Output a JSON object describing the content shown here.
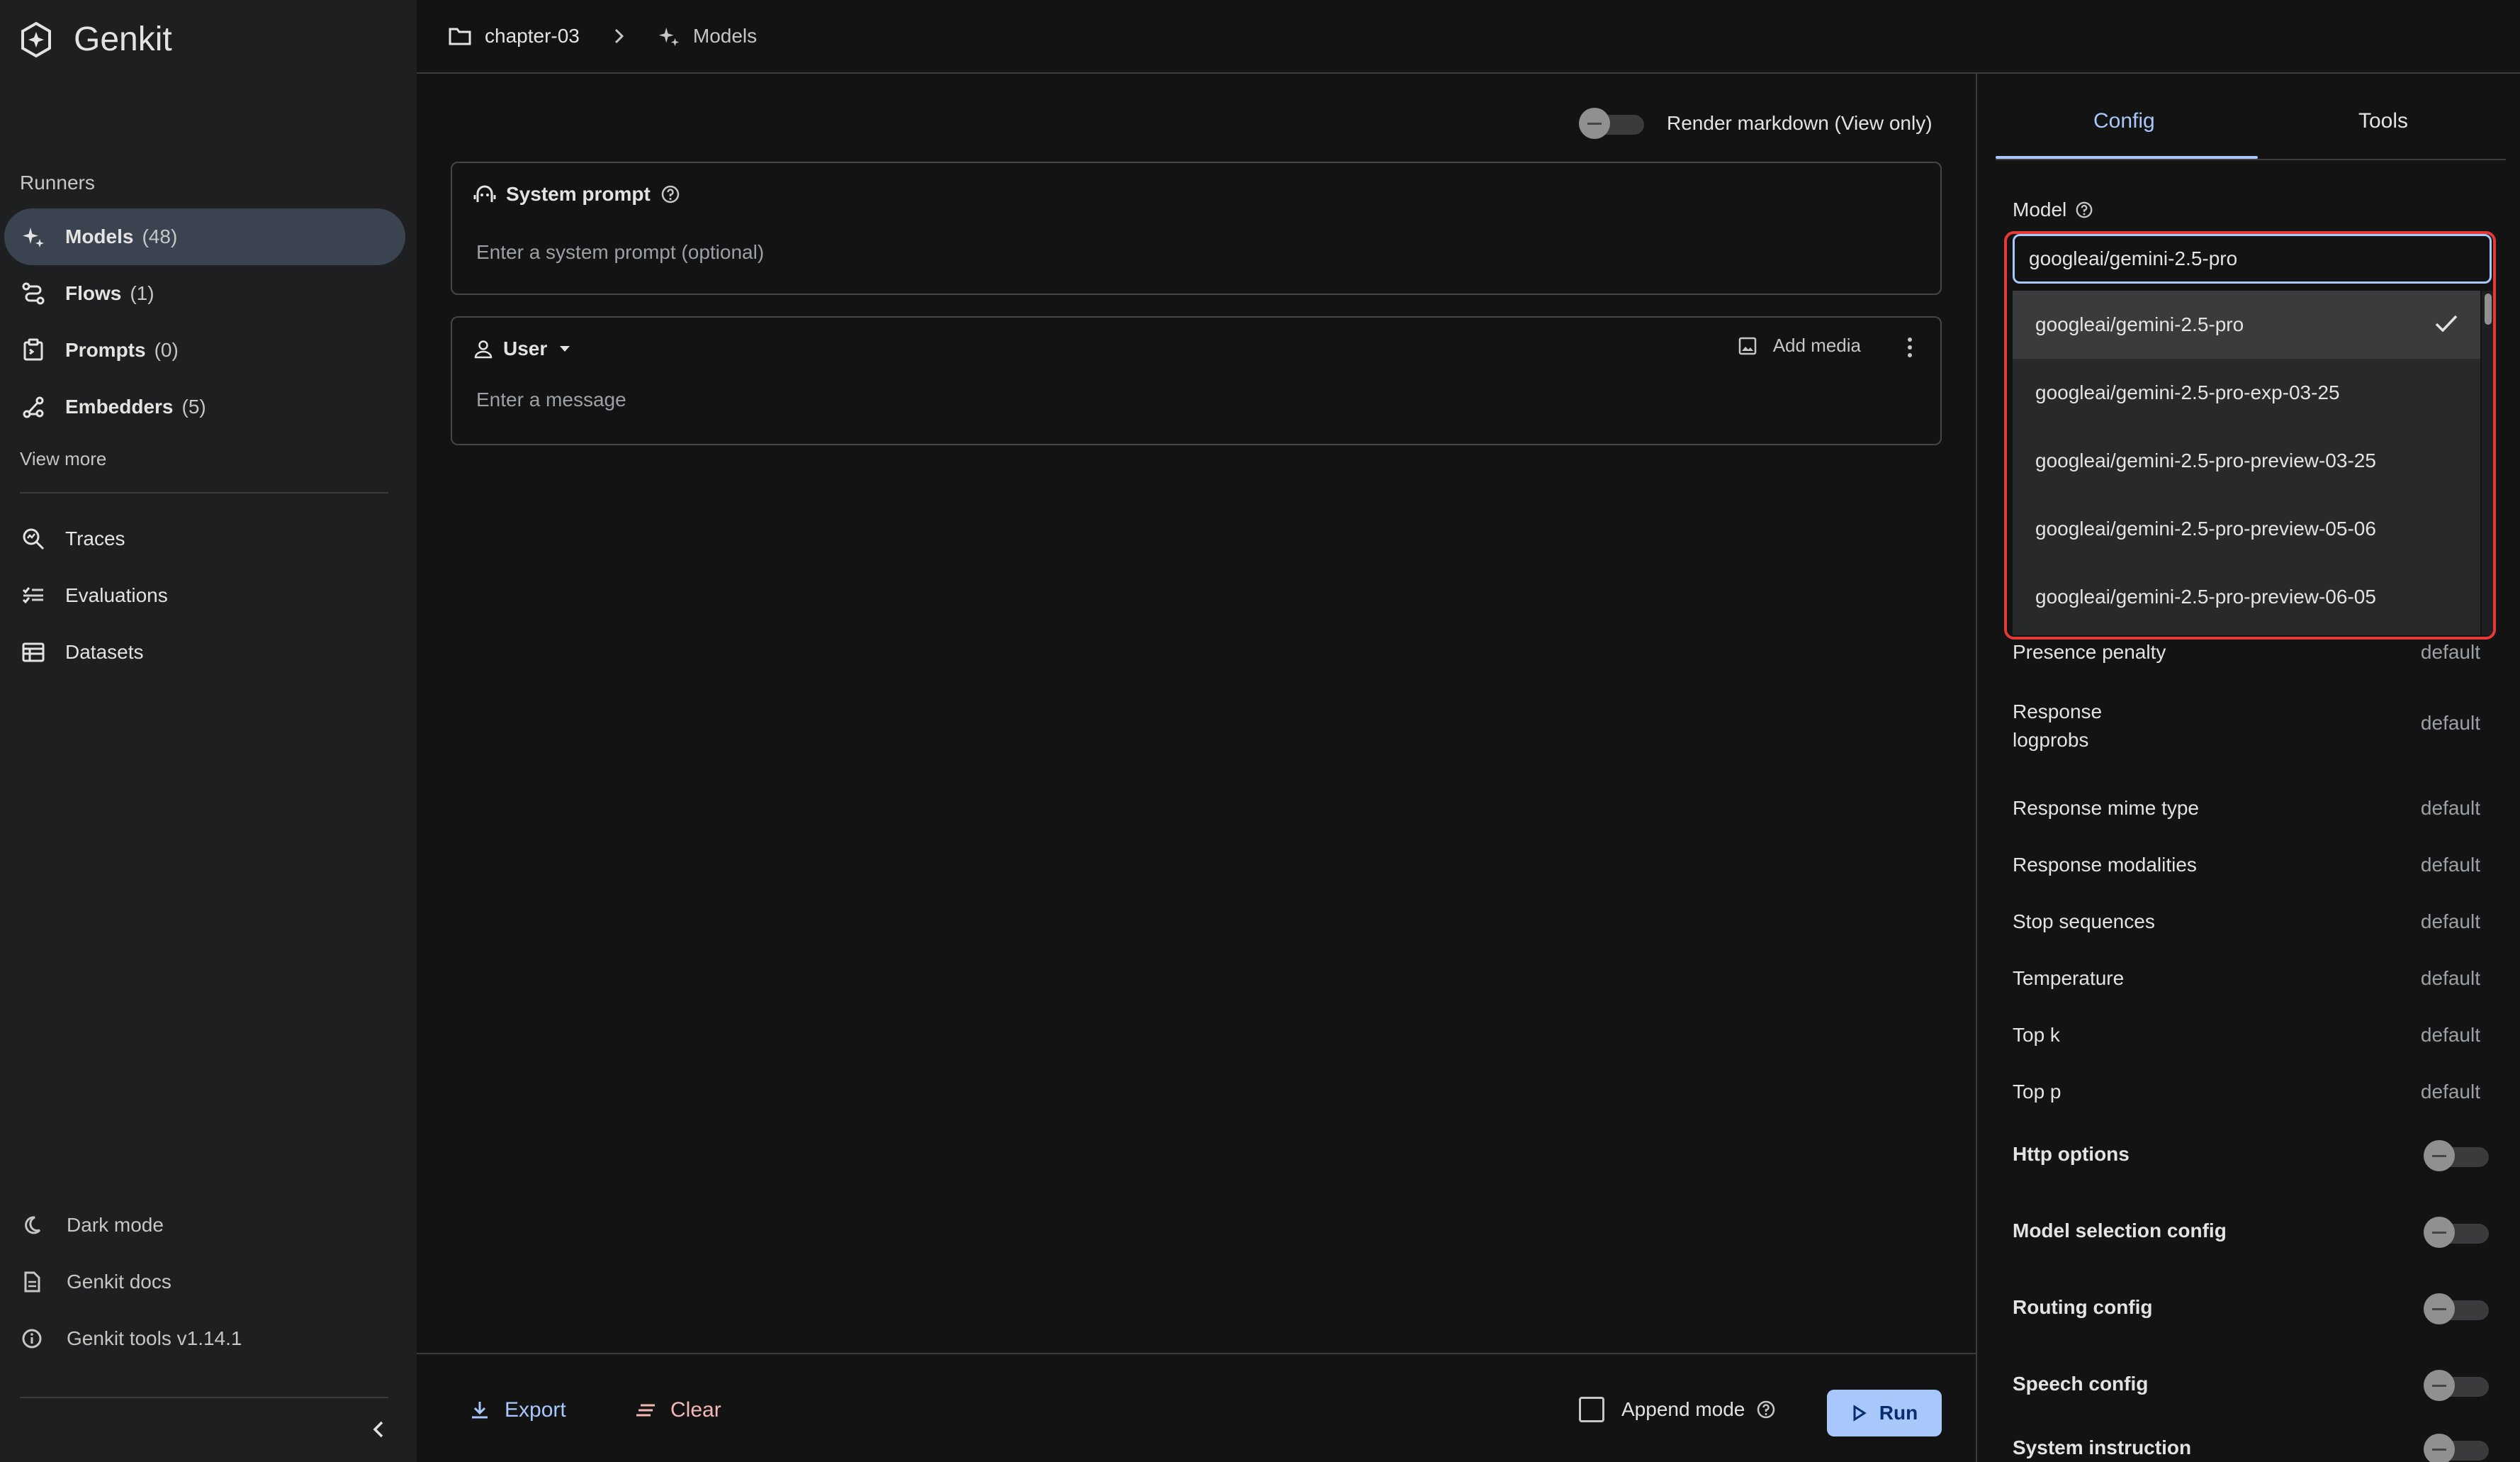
{
  "app": {
    "brand": "Genkit"
  },
  "sidebar": {
    "section_label": "Runners",
    "items": [
      {
        "label": "Models",
        "count": "(48)",
        "icon": "sparkle-icon"
      },
      {
        "label": "Flows",
        "count": "(1)",
        "icon": "flow-icon"
      },
      {
        "label": "Prompts",
        "count": "(0)",
        "icon": "prompt-icon"
      },
      {
        "label": "Embedders",
        "count": "(5)",
        "icon": "embedder-icon"
      }
    ],
    "view_more": "View more",
    "tools": [
      {
        "label": "Traces",
        "icon": "search-traces-icon"
      },
      {
        "label": "Evaluations",
        "icon": "checklist-icon"
      },
      {
        "label": "Datasets",
        "icon": "table-icon"
      }
    ],
    "footer": [
      {
        "label": "Dark mode",
        "icon": "moon-icon"
      },
      {
        "label": "Genkit docs",
        "icon": "document-icon"
      },
      {
        "label": "Genkit tools v1.14.1",
        "icon": "info-icon"
      }
    ]
  },
  "breadcrumb": {
    "project": "chapter-03",
    "page": "Models"
  },
  "main": {
    "render_markdown": "Render markdown (View only)",
    "system_prompt": {
      "label": "System prompt",
      "placeholder": "Enter a system prompt (optional)"
    },
    "user_message": {
      "role": "User",
      "add_media": "Add media",
      "placeholder": "Enter a message"
    }
  },
  "bottom": {
    "export": "Export",
    "clear": "Clear",
    "append_mode": "Append mode",
    "run": "Run"
  },
  "config_panel": {
    "tabs": [
      "Config",
      "Tools"
    ],
    "model_label": "Model",
    "model_value": "googleai/gemini-2.5-pro",
    "model_options": [
      "googleai/gemini-2.5-pro",
      "googleai/gemini-2.5-pro-exp-03-25",
      "googleai/gemini-2.5-pro-preview-03-25",
      "googleai/gemini-2.5-pro-preview-05-06",
      "googleai/gemini-2.5-pro-preview-06-05"
    ],
    "params": [
      {
        "name": "Presence penalty",
        "value": "default"
      },
      {
        "name": "Response logprobs",
        "value": "default"
      },
      {
        "name": "Response mime type",
        "value": "default"
      },
      {
        "name": "Response modalities",
        "value": "default"
      },
      {
        "name": "Stop sequences",
        "value": "default"
      },
      {
        "name": "Temperature",
        "value": "default"
      },
      {
        "name": "Top k",
        "value": "default"
      },
      {
        "name": "Top p",
        "value": "default"
      }
    ],
    "toggles": [
      "Http options",
      "Model selection config",
      "Routing config",
      "Speech config",
      "System instruction"
    ]
  },
  "colors": {
    "accent": "#a8c7fa",
    "danger": "#f2b8b5",
    "highlight": "#e53935"
  }
}
